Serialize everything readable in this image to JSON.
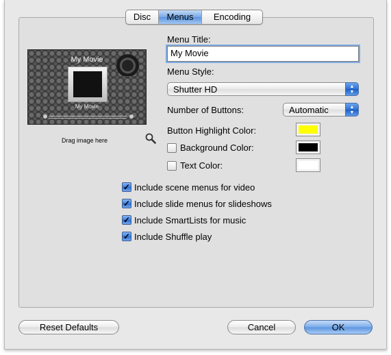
{
  "tabs": [
    {
      "label": "Disc",
      "selected": false
    },
    {
      "label": "Menus",
      "selected": true
    },
    {
      "label": "Encoding",
      "selected": false
    }
  ],
  "preview": {
    "title": "My Movie",
    "subtitle": "My Movie",
    "drag_label": "Drag image here",
    "zoom_icon": "magnifier-icon"
  },
  "form": {
    "menu_title_label": "Menu Title:",
    "menu_title_value": "My Movie",
    "menu_style_label": "Menu Style:",
    "menu_style_value": "Shutter HD",
    "number_of_buttons_label": "Number of Buttons:",
    "number_of_buttons_value": "Automatic",
    "highlight_color_label": "Button Highlight Color:",
    "highlight_color": "#ffff00",
    "background_color_label": "Background Color:",
    "background_color": "#000000",
    "background_color_checked": false,
    "text_color_label": "Text Color:",
    "text_color": "#ffffff",
    "text_color_checked": false
  },
  "options": [
    {
      "label": "Include scene menus for video",
      "checked": true
    },
    {
      "label": "Include slide menus for slideshows",
      "checked": true
    },
    {
      "label": "Include SmartLists for music",
      "checked": true
    },
    {
      "label": "Include Shuffle play",
      "checked": true
    }
  ],
  "buttons": {
    "reset": "Reset Defaults",
    "cancel": "Cancel",
    "ok": "OK"
  }
}
